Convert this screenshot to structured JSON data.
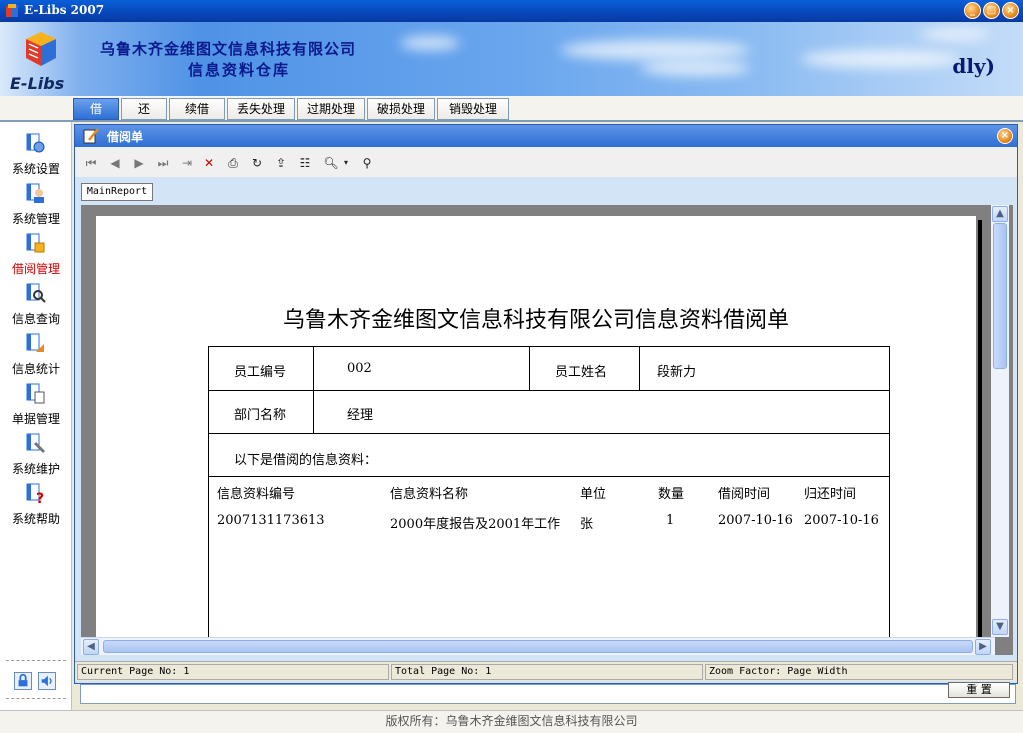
{
  "window": {
    "title": "E-Libs 2007",
    "buttons": [
      "minimize",
      "maximize",
      "close"
    ]
  },
  "banner": {
    "company": "乌鲁木齐金维图文信息科技有限公司",
    "subtitle": "信息资料仓库",
    "logo_text": "E-Libs",
    "user": "dly)"
  },
  "tabs": [
    {
      "label": "借",
      "active": true
    },
    {
      "label": "还"
    },
    {
      "label": "续借"
    },
    {
      "label": "丢失处理"
    },
    {
      "label": "过期处理"
    },
    {
      "label": "破损处理"
    },
    {
      "label": "销毁处理"
    }
  ],
  "sidebar": {
    "items": [
      {
        "label": "系统设置",
        "icon": "settings-icon"
      },
      {
        "label": "系统管理",
        "icon": "user-admin-icon"
      },
      {
        "label": "借阅管理",
        "icon": "borrow-icon",
        "active": true
      },
      {
        "label": "信息查询",
        "icon": "query-icon"
      },
      {
        "label": "信息统计",
        "icon": "statistics-icon"
      },
      {
        "label": "单据管理",
        "icon": "document-icon"
      },
      {
        "label": "系统维护",
        "icon": "maintenance-icon"
      },
      {
        "label": "系统帮助",
        "icon": "help-icon"
      }
    ]
  },
  "inner_window": {
    "title": "借阅单",
    "report_tab": "MainReport"
  },
  "toolbar": {
    "buttons": [
      "first-page-icon",
      "prev-page-icon",
      "next-page-icon",
      "last-page-icon",
      "goto-page-icon",
      "close-icon",
      "print-icon",
      "refresh-icon",
      "export-icon",
      "tree-icon",
      "zoom-icon",
      "dropdown-icon",
      "find-icon"
    ]
  },
  "report": {
    "title": "乌鲁木齐金维图文信息科技有限公司信息资料借阅单",
    "employee_no_label": "员工编号",
    "employee_no": "002",
    "employee_name_label": "员工姓名",
    "employee_name": "段新力",
    "department_label": "部门名称",
    "department": "经理",
    "intro": "以下是借阅的信息资料：",
    "columns": [
      "信息资料编号",
      "信息资料名称",
      "单位",
      "数量",
      "借阅时间",
      "归还时间"
    ],
    "rows": [
      [
        "2007131173613",
        "2000年度报告及2001年工作",
        "张",
        "1",
        "2007-10-16",
        "2007-10-16"
      ]
    ]
  },
  "status": {
    "current_page": "Current Page No: 1",
    "total_page": "Total Page No: 1",
    "zoom": "Zoom Factor: Page Width"
  },
  "under_button": "重 置",
  "footer": "版权所有：乌鲁木齐金维图文信息科技有限公司",
  "colors": {
    "titlebar": "#0846b8",
    "banner_text": "#0a1a8c",
    "active_side": "#d40000"
  }
}
